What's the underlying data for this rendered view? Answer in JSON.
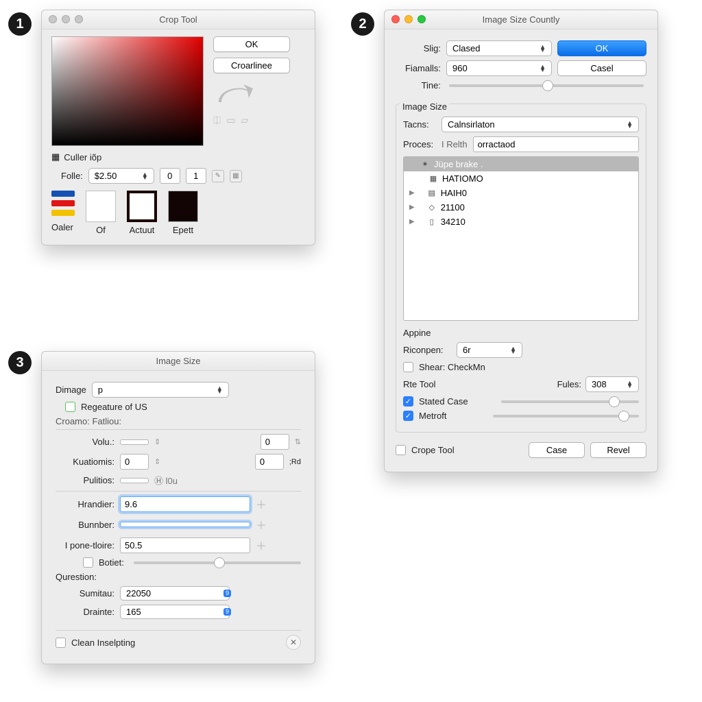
{
  "badges": {
    "one": "1",
    "two": "2",
    "three": "3"
  },
  "panel1": {
    "title": "Crop Tool",
    "ok": "OK",
    "croar": "Croarlinee",
    "culler": "Culler iõp",
    "folle_lbl": "Folle:",
    "folle_val": "$2.50",
    "n0": "0",
    "n1": "1",
    "swatches": {
      "of": "Of",
      "actuut": "Actuut",
      "epett": "Epett"
    },
    "oaler": "Oaler"
  },
  "panel2": {
    "title": "Image Size Countly",
    "ok": "OK",
    "casel": "Casel",
    "slig_lbl": "Slig:",
    "slig_val": "Clased",
    "fiamalls_lbl": "Fiamalls:",
    "fiamalls_val": "960",
    "tine_lbl": "Tine:",
    "group_image_size": "Image Size",
    "tacns_lbl": "Tacns:",
    "tacns_val": "Calnsirlaton",
    "proces_lbl": "Proces:",
    "proces_ro": "I Relth",
    "proces_val": "orractaod",
    "tree": [
      {
        "label": "Jüpe brake .",
        "sel": true,
        "hasTri": false,
        "icon": "star"
      },
      {
        "label": "HATIOMO",
        "sel": false,
        "hasTri": false,
        "icon": "grid"
      },
      {
        "label": "HAIH0",
        "sel": false,
        "hasTri": true,
        "icon": "doc"
      },
      {
        "label": "21100",
        "sel": false,
        "hasTri": true,
        "icon": "diamond"
      },
      {
        "label": "34210",
        "sel": false,
        "hasTri": true,
        "icon": "phone"
      }
    ],
    "appine": "Appine",
    "riconpen_lbl": "Riconpen:",
    "riconpen_val": "6r",
    "shear_lbl": "Shear:  CheckMn",
    "rte_tool": "Rte Tool",
    "fules_lbl": "Fules:",
    "fules_val": "308",
    "stated_case": "Stated Case",
    "metroft": "Metroft",
    "crope_tool": "Crope Tool",
    "case_btn": "Case",
    "revel_btn": "Revel"
  },
  "panel3": {
    "title": "Image Size",
    "dimage_lbl": "Dimage",
    "dimage_val": "p",
    "regeature": "Regeature of US",
    "croamo": "Croamo: Fatliou:",
    "volu_lbl": "Volu.:",
    "volu_a": "",
    "volu_b": "0",
    "kuatiomis_lbl": "Kuatiomis:",
    "kuatiomis_a": "0",
    "kuatiomis_b": "0",
    "rd": ";Rd",
    "pulitios_lbl": "Pulitios:",
    "pulitios_suffix": "Ⓗ l0u",
    "hrandier_lbl": "Hrandier:",
    "hrandier_val": "9.6",
    "bunnber_lbl": "Bunnber:",
    "bunnber_val": "",
    "ipone_lbl": "I pone-tloire:",
    "ipone_val": "50.5",
    "botiet_lbl": "Botiet:",
    "qurestion": "Qurestion:",
    "sumitau_lbl": "Sumitau:",
    "sumitau_val": "22050",
    "sumitau_unit": "9",
    "drainte_lbl": "Drainte:",
    "drainte_val": "165",
    "drainte_unit": "9",
    "clean": "Clean Inselpting"
  }
}
